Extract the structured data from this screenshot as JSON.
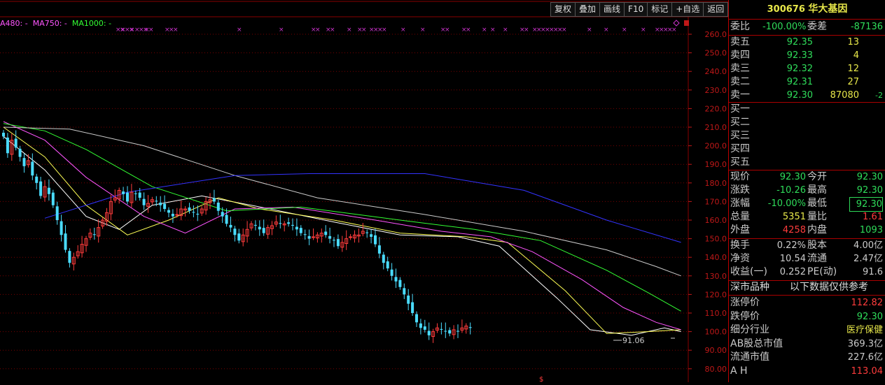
{
  "toolbar": {
    "buttons": [
      "复权",
      "叠加",
      "画线",
      "F10",
      "标记",
      "+自选",
      "返回"
    ]
  },
  "legend": {
    "ma480": "A480: -",
    "ma750": "MA750: -",
    "ma1000": "MA1000: -"
  },
  "colors": {
    "up": "#ff3c3c",
    "down": "#4adcff",
    "ma5": "#ffffff",
    "ma10": "#ffff55",
    "ma20": "#ff55ff",
    "ma30": "#33ff33",
    "ma60": "#cccccc",
    "ma120": "#3333ff",
    "grid": "#7a0000",
    "axis": "#c01818"
  },
  "chart_data": {
    "type": "candlestick",
    "y_ticks": [
      "260.0",
      "250.0",
      "240.0",
      "230.0",
      "220.0",
      "210.0",
      "200.0",
      "190.0",
      "180.0",
      "170.0",
      "160.0",
      "150.0",
      "140.0",
      "130.0",
      "120.0",
      "110.0",
      "100.0",
      "90.00",
      "80.00"
    ],
    "ylim": [
      76,
      264
    ],
    "low_annotation": "91.06",
    "closes": [
      205,
      196,
      203,
      199,
      194,
      189,
      192,
      184,
      180,
      173,
      178,
      174,
      168,
      160,
      152,
      144,
      137,
      140,
      143,
      147,
      150,
      153,
      152,
      156,
      160,
      164,
      170,
      172,
      176,
      174,
      170,
      175,
      174,
      172,
      168,
      169,
      171,
      170,
      168,
      166,
      164,
      162,
      163,
      166,
      166,
      165,
      164,
      163,
      166,
      170,
      171,
      170,
      165,
      162,
      158,
      156,
      152,
      149,
      152,
      155,
      158,
      157,
      155,
      153,
      156,
      157,
      159,
      158,
      158,
      158,
      157,
      155,
      153,
      152,
      150,
      151,
      152,
      153,
      152,
      150,
      149,
      146,
      148,
      150,
      151,
      152,
      152,
      154,
      153,
      151,
      147,
      142,
      137,
      134,
      130,
      127,
      124,
      120,
      115,
      110,
      105,
      102,
      101,
      98,
      100,
      102,
      101,
      100,
      99,
      101,
      100,
      102,
      103,
      102
    ],
    "ma_series": [
      {
        "name": "MA5",
        "values": [
          [
            0,
            205
          ],
          [
            10,
            187
          ],
          [
            20,
            162
          ],
          [
            28,
            155
          ],
          [
            36,
            168
          ],
          [
            48,
            173
          ],
          [
            60,
            168
          ],
          [
            80,
            159
          ],
          [
            96,
            152
          ],
          [
            110,
            151
          ],
          [
            120,
            146
          ],
          [
            134,
            118
          ],
          [
            142,
            101
          ],
          [
            152,
            98
          ],
          [
            160,
            102
          ],
          [
            164,
            100
          ]
        ]
      },
      {
        "name": "MA10",
        "values": [
          [
            0,
            210
          ],
          [
            10,
            194
          ],
          [
            20,
            168
          ],
          [
            30,
            152
          ],
          [
            40,
            160
          ],
          [
            52,
            172
          ],
          [
            62,
            166
          ],
          [
            80,
            160
          ],
          [
            96,
            153
          ],
          [
            112,
            151
          ],
          [
            122,
            148
          ],
          [
            136,
            122
          ],
          [
            146,
            99
          ],
          [
            156,
            100
          ],
          [
            164,
            101
          ]
        ]
      },
      {
        "name": "MA20",
        "values": [
          [
            0,
            213
          ],
          [
            10,
            203
          ],
          [
            20,
            183
          ],
          [
            34,
            162
          ],
          [
            44,
            153
          ],
          [
            56,
            166
          ],
          [
            70,
            167
          ],
          [
            90,
            160
          ],
          [
            106,
            154
          ],
          [
            118,
            151
          ],
          [
            128,
            143
          ],
          [
            140,
            128
          ],
          [
            150,
            113
          ],
          [
            158,
            105
          ],
          [
            164,
            101
          ]
        ]
      },
      {
        "name": "MA30",
        "values": [
          [
            0,
            212
          ],
          [
            10,
            208
          ],
          [
            20,
            198
          ],
          [
            36,
            178
          ],
          [
            54,
            165
          ],
          [
            72,
            167
          ],
          [
            96,
            160
          ],
          [
            114,
            155
          ],
          [
            130,
            149
          ],
          [
            146,
            133
          ],
          [
            156,
            121
          ],
          [
            164,
            111
          ]
        ]
      },
      {
        "name": "MA60",
        "values": [
          [
            0,
            210
          ],
          [
            16,
            209
          ],
          [
            34,
            200
          ],
          [
            56,
            184
          ],
          [
            76,
            172
          ],
          [
            102,
            163
          ],
          [
            126,
            154
          ],
          [
            146,
            144
          ],
          [
            158,
            135
          ],
          [
            164,
            130
          ]
        ]
      },
      {
        "name": "MA120",
        "values": [
          [
            10,
            161
          ],
          [
            30,
            175
          ],
          [
            56,
            184
          ],
          [
            74,
            185
          ],
          [
            102,
            185
          ],
          [
            126,
            176
          ],
          [
            146,
            160
          ],
          [
            164,
            148
          ]
        ]
      }
    ]
  },
  "panel": {
    "header": {
      "code": "300676",
      "name": "华大基因"
    },
    "weibi": {
      "label": "委比",
      "value": "-100.00%",
      "label2": "委差",
      "value2": "-87136"
    },
    "asks": [
      {
        "label": "卖五",
        "price": "92.35",
        "vol": "13",
        "chg": ""
      },
      {
        "label": "卖四",
        "price": "92.33",
        "vol": "4",
        "chg": ""
      },
      {
        "label": "卖三",
        "price": "92.32",
        "vol": "12",
        "chg": ""
      },
      {
        "label": "卖二",
        "price": "92.31",
        "vol": "27",
        "chg": ""
      },
      {
        "label": "卖一",
        "price": "92.30",
        "vol": "87080",
        "chg": "-2"
      }
    ],
    "bids": [
      "买一",
      "买二",
      "买三",
      "买四",
      "买五"
    ],
    "quote": [
      {
        "l1": "现价",
        "v1": "92.30",
        "l2": "今开",
        "v2": "92.30",
        "c1": "g",
        "c2": "g"
      },
      {
        "l1": "涨跌",
        "v1": "-10.26",
        "l2": "最高",
        "v2": "92.30",
        "c1": "g",
        "c2": "g"
      },
      {
        "l1": "涨幅",
        "v1": "-10.00%",
        "l2": "最低",
        "v2": "92.30",
        "c1": "g",
        "c2": "g"
      },
      {
        "l1": "总量",
        "v1": "5351",
        "l2": "量比",
        "v2": "1.61",
        "c1": "y",
        "c2": "r"
      },
      {
        "l1": "外盘",
        "v1": "4258",
        "l2": "内盘",
        "v2": "1093",
        "c1": "r",
        "c2": "g"
      }
    ],
    "stats": [
      {
        "l1": "换手",
        "v1": "0.22%",
        "l2": "股本",
        "v2": "4.00亿"
      },
      {
        "l1": "净资",
        "v1": "10.54",
        "l2": "流通",
        "v2": "2.47亿"
      },
      {
        "l1": "收益(一)",
        "v1": "0.252",
        "l2": "PE(动)",
        "v2": "91.6"
      }
    ],
    "market_note": {
      "label": "深市品种",
      "text": "以下数据仅供参考"
    },
    "limits": [
      {
        "label": "涨停价",
        "value": "112.82",
        "color": "r"
      },
      {
        "label": "跌停价",
        "value": "92.30",
        "color": "g"
      },
      {
        "label": "细分行业",
        "value": "医疗保健",
        "color": "y"
      },
      {
        "label": "AB股总市值",
        "value": "369.3亿",
        "color": "w"
      },
      {
        "label": "流通市值",
        "value": "227.6亿",
        "color": "w"
      },
      {
        "label": "A H",
        "value": "113.04",
        "color": "r"
      }
    ]
  }
}
